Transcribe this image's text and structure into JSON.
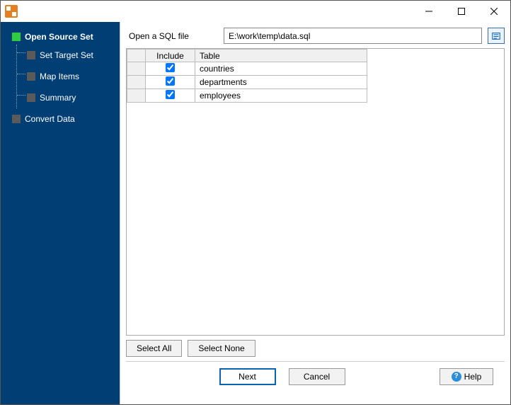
{
  "sidebar": {
    "steps": [
      {
        "label": "Open Source Set",
        "current": true
      },
      {
        "label": "Set Target Set"
      },
      {
        "label": "Map Items"
      },
      {
        "label": "Summary"
      }
    ],
    "final_step": {
      "label": "Convert Data"
    }
  },
  "file_row": {
    "label": "Open a SQL file",
    "path": "E:\\work\\temp\\data.sql"
  },
  "table": {
    "headers": {
      "include": "Include",
      "table": "Table"
    },
    "rows": [
      {
        "include": true,
        "name": "countries"
      },
      {
        "include": true,
        "name": "departments"
      },
      {
        "include": true,
        "name": "employees"
      }
    ]
  },
  "selection_buttons": {
    "select_all": "Select All",
    "select_none": "Select None"
  },
  "footer": {
    "next": "Next",
    "cancel": "Cancel",
    "help": "Help"
  }
}
